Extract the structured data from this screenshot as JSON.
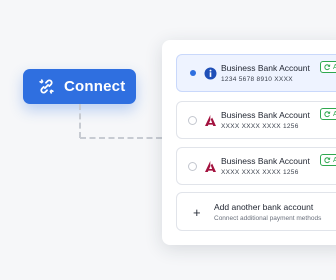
{
  "connect": {
    "label": "Connect",
    "icon": "link-icon",
    "color": "#2f6fe0"
  },
  "accounts": [
    {
      "title": "Business Bank Account",
      "number": "1234 5678 8910 XXXX",
      "badge": "A",
      "selected": true,
      "bank_icon": "info-bank-logo"
    },
    {
      "title": "Business Bank Account",
      "number": "XXXX XXXX XXXX 1256",
      "badge": "A",
      "selected": false,
      "bank_icon": "axis-bank-logo"
    },
    {
      "title": "Business Bank Account",
      "number": "XXXX XXXX XXXX 1256",
      "badge": "A",
      "selected": false,
      "bank_icon": "axis-bank-logo"
    }
  ],
  "add_account": {
    "title": "Add another bank account",
    "subtitle": "Connect additional payment methods",
    "icon": "plus-icon"
  },
  "colors": {
    "accent": "#2f6fe0",
    "success": "#2fa84f",
    "axis": "#a3123f"
  }
}
